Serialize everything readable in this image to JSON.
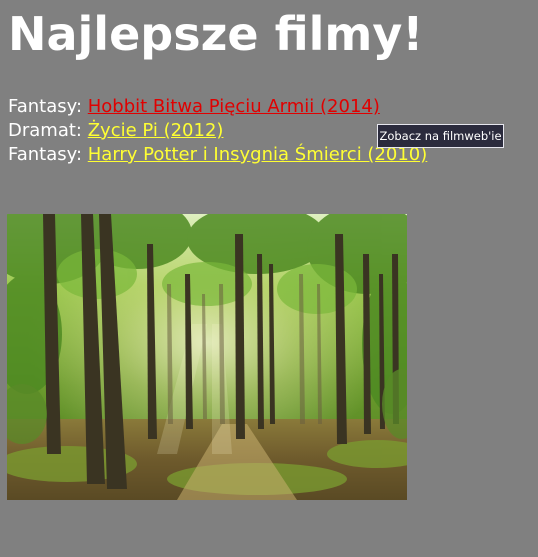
{
  "page": {
    "title": "Najlepsze filmy!",
    "background": "#808080"
  },
  "movies": [
    {
      "genre": "Fantasy:",
      "title": "Hobbit Bitwa Pięciu Armii (2014)",
      "color": "#e00000"
    },
    {
      "genre": "Dramat:",
      "title": "Życie Pi (2012)",
      "color": "#ffff33"
    },
    {
      "genre": "Fantasy:",
      "title": "Harry Potter i Insygnia Śmierci (2010)",
      "color": "#ffff33"
    }
  ],
  "tooltip": {
    "text": "Zobacz na filmweb'ie"
  },
  "image": {
    "icon": "forest-photo"
  }
}
